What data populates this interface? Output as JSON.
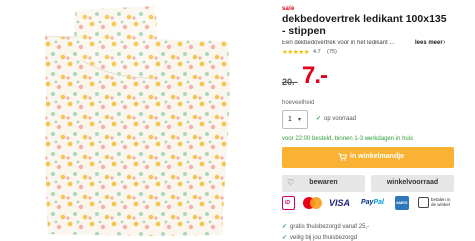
{
  "product": {
    "sale_label": "sale",
    "title": "dekbedovertrek ledikant 100x135 - stippen",
    "description": "Een dekbedovertrek voor in het ledikant ...",
    "more_label": "lees meer",
    "more_arrow": "›",
    "rating": {
      "stars": "★★★★★",
      "score": "4.7",
      "count": "(75)"
    },
    "price_old": "20.-",
    "price_new": "7.-"
  },
  "colors": {
    "sale_red": "#e2001a",
    "cta_yellow": "#f9b233",
    "stock_green": "#2e9e3a",
    "star_yellow": "#f5b800"
  },
  "quantity": {
    "label": "hoeveelheid",
    "value": "1",
    "arrow": "▾",
    "stock_check": "✓",
    "stock_text": "op voorraad"
  },
  "delivery_text": "voor 22:00 besteld, binnen 1-3 werkdagen in huis",
  "buttons": {
    "cart_label": "in winkelmandje",
    "cart_icon": "cart-icon",
    "save_label": "bewaren",
    "save_icon": "♡",
    "stock_label": "winkelvoorraad"
  },
  "payments": {
    "ideal": "iD",
    "visa": "VISA",
    "paypal_a": "Pay",
    "paypal_b": "Pal",
    "amex": "AMEX",
    "rekening": "betalen in de winkel"
  },
  "usps": [
    {
      "check": "✓",
      "text": "gratis thuisbezorgd vanaf 25,-"
    },
    {
      "check": "✓",
      "text": "veilig bij jou thuisbezorgd"
    }
  ]
}
